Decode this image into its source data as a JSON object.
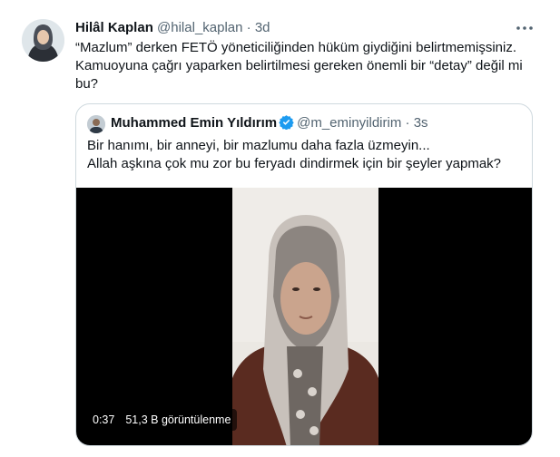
{
  "tweet": {
    "author_name": "Hilâl Kaplan",
    "handle": "@hilal_kaplan",
    "separator": "·",
    "time": "3d",
    "more_icon": "more-horizontal-icon",
    "text": "“Mazlum” derken FETÖ yöneticiliğinden hüküm giydiğini belirtmemişsiniz. Kamuoyuna çağrı yaparken belirtilmesi gereken önemli bir “detay” değil mi bu?"
  },
  "quote": {
    "author_name": "Muhammed Emin Yıldırım",
    "verified_icon": "verified-badge-icon",
    "verified_color": "#1d9bf0",
    "handle": "@m_eminyildirim",
    "separator": "·",
    "time": "3s",
    "line1": "Bir hanımı, bir anneyi, bir mazlumu daha fazla üzmeyin...",
    "line2": "Allah aşkına çok mu zor bu feryadı dindirmek için bir şeyler yapmak?",
    "media": {
      "duration": "0:37",
      "views": "51,3 B görüntülenme"
    }
  }
}
